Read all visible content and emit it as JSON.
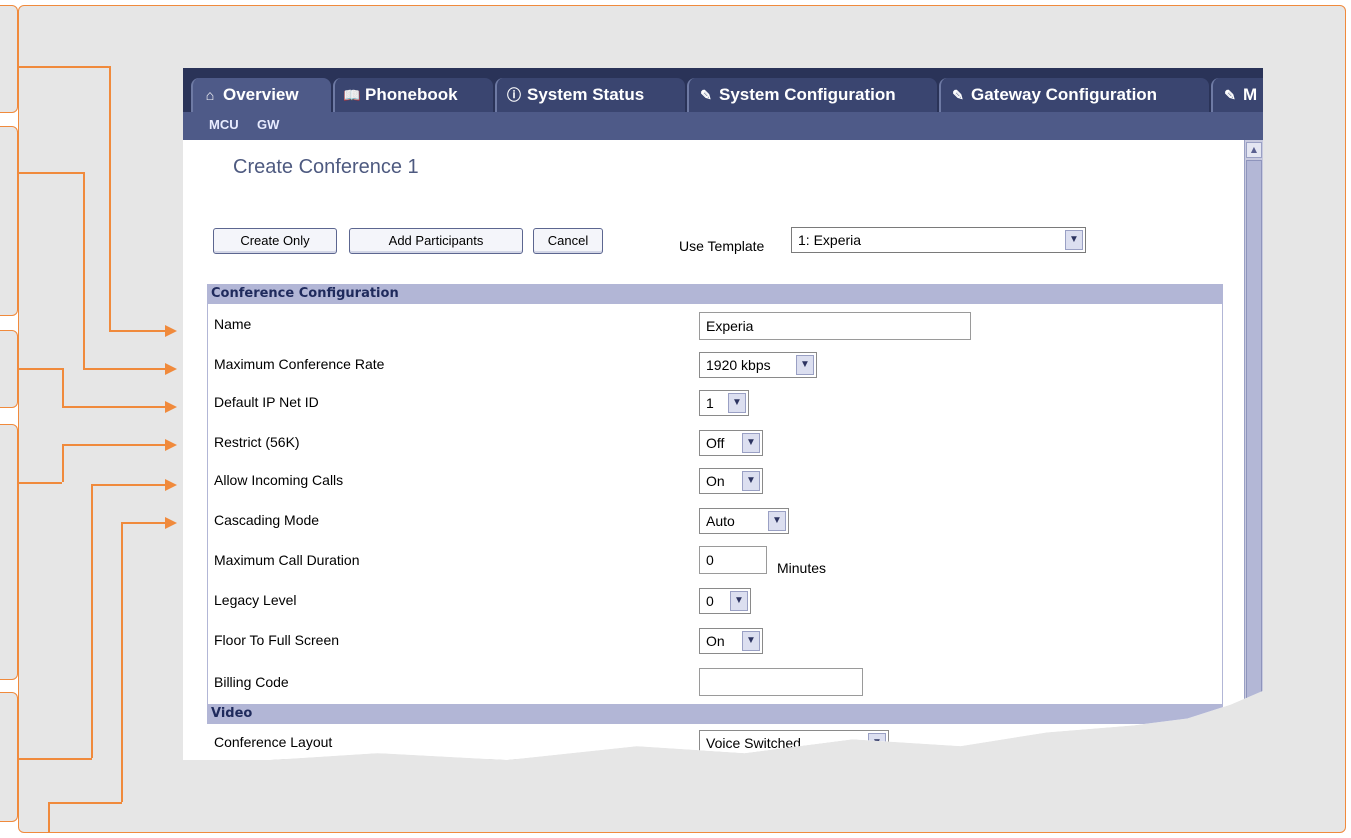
{
  "tabs": [
    {
      "label": "Overview",
      "icon": "briefcase-icon",
      "glyph": "⌂",
      "active": true
    },
    {
      "label": "Phonebook",
      "icon": "book-icon",
      "glyph": "📖",
      "active": false
    },
    {
      "label": "System Status",
      "icon": "info-icon",
      "glyph": "ⓘ",
      "active": false
    },
    {
      "label": "System Configuration",
      "icon": "wrench-icon",
      "glyph": "✎",
      "active": false
    },
    {
      "label": "Gateway Configuration",
      "icon": "wrench-icon",
      "glyph": "✎",
      "active": false
    },
    {
      "label": "M",
      "icon": "wrench-icon",
      "glyph": "✎",
      "active": false
    }
  ],
  "subnav": {
    "mcu": "MCU",
    "gw": "GW"
  },
  "page_title": "Create Conference 1",
  "buttons": {
    "create_only": "Create Only",
    "add_participants": "Add Participants",
    "cancel": "Cancel"
  },
  "template": {
    "label": "Use Template",
    "value": "1:   Experia"
  },
  "sections": {
    "conference": "Conference Configuration",
    "video": "Video"
  },
  "fields": {
    "name": {
      "label": "Name",
      "value": "Experia"
    },
    "max_rate": {
      "label": "Maximum Conference Rate",
      "value": "1920 kbps"
    },
    "net_id": {
      "label": "Default IP Net ID",
      "value": "1"
    },
    "restrict": {
      "label": "Restrict (56K)",
      "value": "Off"
    },
    "incoming": {
      "label": "Allow Incoming Calls",
      "value": "On"
    },
    "cascading": {
      "label": "Cascading Mode",
      "value": "Auto"
    },
    "duration": {
      "label": "Maximum Call Duration",
      "value": "0",
      "unit": "Minutes"
    },
    "legacy": {
      "label": "Legacy Level",
      "value": "0"
    },
    "floor": {
      "label": "Floor To Full Screen",
      "value": "On"
    },
    "billing": {
      "label": "Billing Code",
      "value": ""
    },
    "layout": {
      "label": "Conference Layout",
      "value": "Voice Switched"
    }
  },
  "colors": {
    "accent": "#f08a3c",
    "tab_bar": "#2a3358",
    "section": "#b2b6d6"
  }
}
